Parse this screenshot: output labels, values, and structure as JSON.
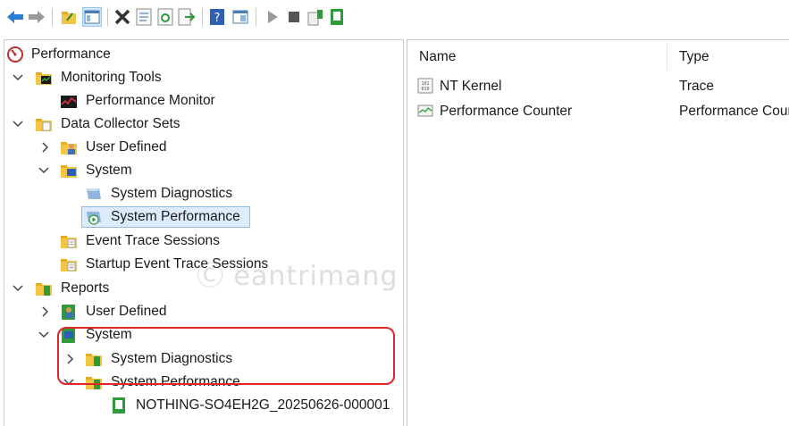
{
  "toolbar": {
    "buttons": [
      "back-icon",
      "forward-icon",
      "up-folder-icon",
      "show-hide-tree-icon",
      "delete-icon",
      "properties-icon",
      "refresh-icon",
      "export-list-icon",
      "help-icon",
      "view-icon",
      "start-icon",
      "stop-icon",
      "new-data-collector-icon",
      "latest-report-icon"
    ]
  },
  "tree": {
    "root": "Performance",
    "monitoring_tools": "Monitoring Tools",
    "performance_monitor": "Performance Monitor",
    "data_collector_sets": "Data Collector Sets",
    "dcs_user_defined": "User Defined",
    "dcs_system": "System",
    "dcs_system_diagnostics": "System Diagnostics",
    "dcs_system_performance": "System Performance",
    "event_trace_sessions": "Event Trace Sessions",
    "startup_event_trace_sessions": "Startup Event Trace Sessions",
    "reports": "Reports",
    "rep_user_defined": "User Defined",
    "rep_system": "System",
    "rep_system_diagnostics": "System Diagnostics",
    "rep_system_performance": "System Performance",
    "report_file": "NOTHING-SO4EH2G_20250626-000001"
  },
  "list": {
    "headers": {
      "name": "Name",
      "type": "Type"
    },
    "rows": [
      {
        "name": "NT Kernel",
        "type": "Trace"
      },
      {
        "name": "Performance Counter",
        "type": "Performance Counter"
      }
    ]
  },
  "watermark": "Ⓒ eantrimang",
  "colors": {
    "accent_highlight": "#e0262b",
    "selection": "#dcecfc",
    "selection_border": "#8fbde8"
  }
}
